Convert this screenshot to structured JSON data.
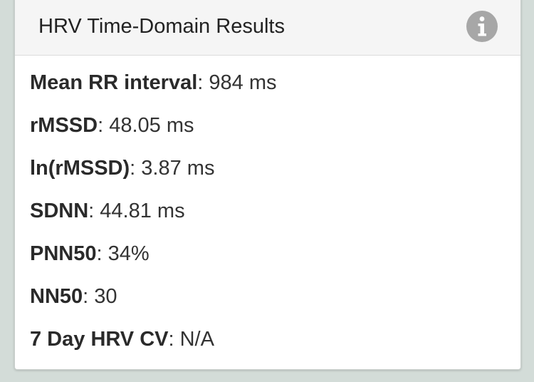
{
  "card": {
    "title": "HRV Time-Domain Results",
    "info_icon": "info-icon",
    "icon_color": "#a7a7a7"
  },
  "metrics": [
    {
      "label": "Mean RR interval",
      "value": ": 984 ms"
    },
    {
      "label": "rMSSD",
      "value": ": 48.05 ms"
    },
    {
      "label": "ln(rMSSD)",
      "value": ": 3.87 ms"
    },
    {
      "label": "SDNN",
      "value": ": 44.81 ms"
    },
    {
      "label": "PNN50",
      "value": ": 34%"
    },
    {
      "label": "NN50",
      "value": ": 30"
    },
    {
      "label": "7 Day HRV CV",
      "value": ": N/A"
    }
  ]
}
